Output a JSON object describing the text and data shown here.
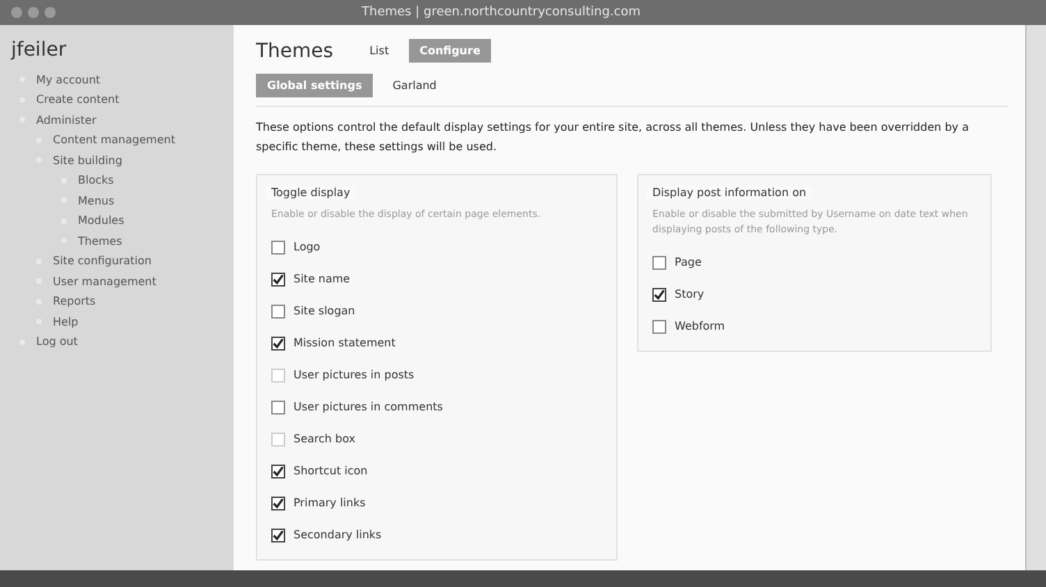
{
  "window": {
    "title": "Themes | green.northcountryconsulting.com"
  },
  "sidebar": {
    "user": "jfeiler",
    "items": [
      {
        "label": "My account"
      },
      {
        "label": "Create content"
      },
      {
        "label": "Administer",
        "children": [
          {
            "label": "Content management"
          },
          {
            "label": "Site building",
            "children": [
              {
                "label": "Blocks"
              },
              {
                "label": "Menus"
              },
              {
                "label": "Modules"
              },
              {
                "label": "Themes"
              }
            ]
          },
          {
            "label": "Site configuration"
          },
          {
            "label": "User management"
          },
          {
            "label": "Reports"
          },
          {
            "label": "Help"
          }
        ]
      },
      {
        "label": "Log out"
      }
    ]
  },
  "page_title": "Themes",
  "tabs": [
    {
      "label": "List",
      "selected": false
    },
    {
      "label": "Configure",
      "selected": true
    }
  ],
  "subtabs": [
    {
      "label": "Global settings",
      "selected": true
    },
    {
      "label": "Garland",
      "selected": false
    }
  ],
  "intro": "These options control the default display settings for your entire site, across all themes. Unless they have been overridden by a specific theme, these settings will be used.",
  "toggle_display": {
    "legend": "Toggle display",
    "description": "Enable or disable the display of certain page elements.",
    "items": [
      {
        "label": "Logo",
        "checked": false,
        "disabled": false
      },
      {
        "label": "Site name",
        "checked": true,
        "disabled": false
      },
      {
        "label": "Site slogan",
        "checked": false,
        "disabled": false
      },
      {
        "label": "Mission statement",
        "checked": true,
        "disabled": false
      },
      {
        "label": "User pictures in posts",
        "checked": false,
        "disabled": true
      },
      {
        "label": "User pictures in comments",
        "checked": false,
        "disabled": false
      },
      {
        "label": "Search box",
        "checked": false,
        "disabled": true
      },
      {
        "label": "Shortcut icon",
        "checked": true,
        "disabled": false
      },
      {
        "label": "Primary links",
        "checked": true,
        "disabled": false
      },
      {
        "label": "Secondary links",
        "checked": true,
        "disabled": false
      }
    ]
  },
  "post_info": {
    "legend": "Display post information on",
    "description": "Enable or disable the submitted by Username on date text when displaying posts of the following type.",
    "items": [
      {
        "label": "Page",
        "checked": false,
        "disabled": false
      },
      {
        "label": "Story",
        "checked": true,
        "disabled": false
      },
      {
        "label": "Webform",
        "checked": false,
        "disabled": false
      }
    ]
  }
}
